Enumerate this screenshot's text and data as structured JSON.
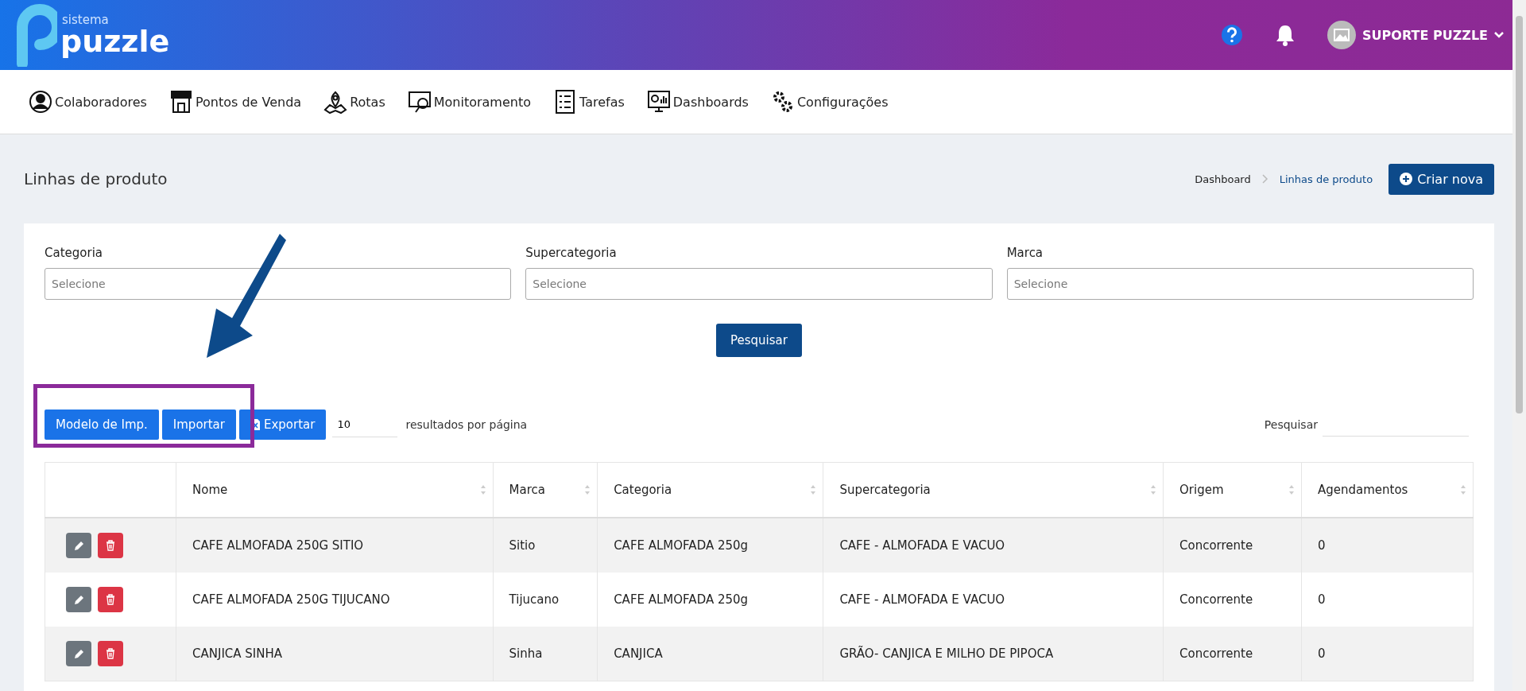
{
  "header": {
    "logo_small": "sistema",
    "logo_big": "puzzle",
    "user": "SUPORTE PUZZLE"
  },
  "nav": [
    {
      "label": "Colaboradores",
      "kind": "person"
    },
    {
      "label": "Pontos de Venda",
      "kind": "store"
    },
    {
      "label": "Rotas",
      "kind": "map"
    },
    {
      "label": "Monitoramento",
      "kind": "monitor"
    },
    {
      "label": "Tarefas",
      "kind": "list"
    },
    {
      "label": "Dashboards",
      "kind": "chart"
    },
    {
      "label": "Configurações",
      "kind": "gears"
    }
  ],
  "page": {
    "title": "Linhas de produto",
    "breadcrumb": [
      "Dashboard",
      "Linhas de produto"
    ],
    "create_button": "Criar nova"
  },
  "filters": [
    {
      "label": "Categoria",
      "placeholder": "Selecione"
    },
    {
      "label": "Supercategoria",
      "placeholder": "Selecione"
    },
    {
      "label": "Marca",
      "placeholder": "Selecione"
    }
  ],
  "search_button": "Pesquisar",
  "toolbar": {
    "buttons": [
      {
        "label": "Modelo de Imp.",
        "kind": "plain"
      },
      {
        "label": "Importar",
        "kind": "plain"
      },
      {
        "label": "Exportar",
        "kind": "excel"
      }
    ],
    "page_size": "10",
    "page_size_label": "resultados por página",
    "search_label": "Pesquisar"
  },
  "table": {
    "columns": [
      "Nome",
      "Marca",
      "Categoria",
      "Supercategoria",
      "Origem",
      "Agendamentos"
    ],
    "rows": [
      [
        "CAFE ALMOFADA 250G SITIO",
        "Sitio",
        "CAFE ALMOFADA 250g",
        "CAFE - ALMOFADA E VACUO",
        "Concorrente",
        "0"
      ],
      [
        "CAFE ALMOFADA 250G TIJUCANO",
        "Tijucano",
        "CAFE ALMOFADA 250g",
        "CAFE - ALMOFADA E VACUO",
        "Concorrente",
        "0"
      ],
      [
        "CANJICA SINHA",
        "Sinha",
        "CANJICA",
        "GRÃO- CANJICA E MILHO DE PIPOCA",
        "Concorrente",
        "0"
      ]
    ]
  }
}
